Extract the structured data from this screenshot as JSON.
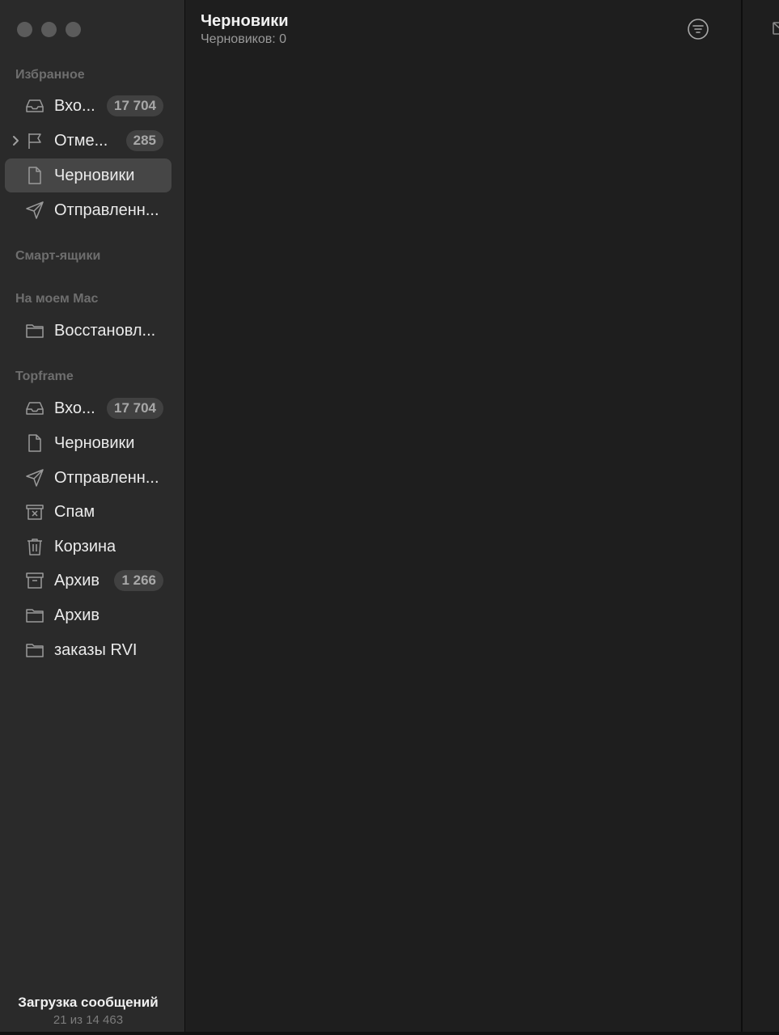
{
  "sidebar": {
    "sections": {
      "favorites": "Избранное",
      "smart": "Смарт-ящики",
      "on_mac": "На моем Mac",
      "account": "Topframe"
    },
    "favorites": [
      {
        "label": "Вхо...",
        "badge": "17 704",
        "icon": "inbox-icon"
      },
      {
        "label": "Отме...",
        "badge": "285",
        "icon": "flag-icon"
      },
      {
        "label": "Черновики",
        "icon": "document-icon"
      },
      {
        "label": "Отправленн...",
        "icon": "paper-plane-icon"
      }
    ],
    "on_mac": [
      {
        "label": "Восстановл...",
        "icon": "folder-icon"
      }
    ],
    "account": [
      {
        "label": "Вхо...",
        "badge": "17 704",
        "icon": "inbox-icon"
      },
      {
        "label": "Черновики",
        "icon": "document-icon"
      },
      {
        "label": "Отправленн...",
        "icon": "paper-plane-icon"
      },
      {
        "label": "Спам",
        "icon": "junk-icon"
      },
      {
        "label": "Корзина",
        "icon": "trash-icon"
      },
      {
        "label": "Архив",
        "badge": "1 266",
        "icon": "archive-box-icon"
      },
      {
        "label": "Архив",
        "icon": "folder-icon"
      },
      {
        "label": "заказы RVI",
        "icon": "folder-icon"
      }
    ],
    "status": {
      "title": "Загрузка сообщений",
      "progress": "21 из 14 463"
    }
  },
  "list": {
    "title": "Черновики",
    "subtitle": "Черновиков: 0"
  },
  "colors": {
    "sidebar_bg": "#2a2a2a",
    "list_bg": "#1e1e1e",
    "selected_bg": "#464646",
    "badge_bg": "#414141"
  }
}
